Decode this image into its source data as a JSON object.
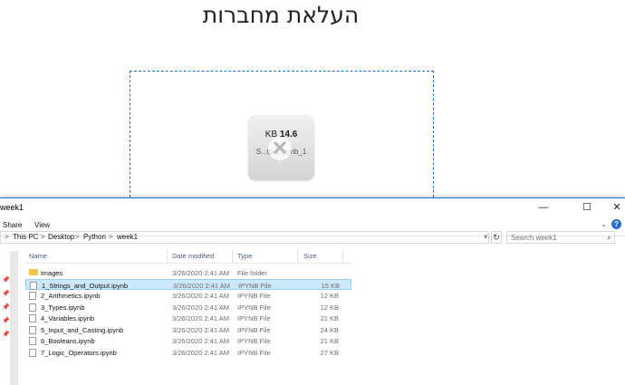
{
  "upload": {
    "title": "העלאת מחברות",
    "file_card": {
      "size_prefix": "KB ",
      "size_value": "14.6",
      "filename": "1_S...tput.ipynb",
      "remove_glyph": "✕"
    }
  },
  "explorer": {
    "title": "week1",
    "controls": {
      "minimize": "—",
      "maximize": "☐",
      "close": "✕"
    },
    "ribbon": {
      "tabs": [
        "Share",
        "View"
      ],
      "expand": "⌄",
      "help": "?"
    },
    "address": {
      "chevron": ">",
      "crumbs": [
        "This PC",
        "Desktop",
        "Python",
        "week1"
      ],
      "dropdown": "∨",
      "refresh": "↻"
    },
    "search": {
      "placeholder": "Search week1",
      "icon": "⌕"
    },
    "columns": {
      "name": "Name",
      "date": "Date modified",
      "type": "Type",
      "size": "Size"
    },
    "files": [
      {
        "name": "images",
        "date": "3/26/2020 2:41 AM",
        "type": "File folder",
        "size": "",
        "icon": "folder-icon"
      },
      {
        "name": "1_Strings_and_Output.ipynb",
        "date": "3/26/2020 2:41 AM",
        "type": "IPYNB File",
        "size": "15 KB",
        "icon": "file-icon",
        "selected": true
      },
      {
        "name": "2_Arithmetics.ipynb",
        "date": "3/26/2020 2:41 AM",
        "type": "IPYNB File",
        "size": "12 KB",
        "icon": "file-icon"
      },
      {
        "name": "3_Types.ipynb",
        "date": "3/26/2020 2:41 AM",
        "type": "IPYNB File",
        "size": "12 KB",
        "icon": "file-icon"
      },
      {
        "name": "4_Variables.ipynb",
        "date": "3/26/2020 2:41 AM",
        "type": "IPYNB File",
        "size": "21 KB",
        "icon": "file-icon"
      },
      {
        "name": "5_Input_and_Casting.ipynb",
        "date": "3/26/2020 2:41 AM",
        "type": "IPYNB File",
        "size": "24 KB",
        "icon": "file-icon"
      },
      {
        "name": "6_Booleans.ipynb",
        "date": "3/26/2020 2:41 AM",
        "type": "IPYNB File",
        "size": "21 KB",
        "icon": "file-icon"
      },
      {
        "name": "7_Logic_Operators.ipynb",
        "date": "3/26/2020 2:41 AM",
        "type": "IPYNB File",
        "size": "27 KB",
        "icon": "file-icon"
      }
    ],
    "pin_glyph": "📌"
  },
  "colors": {
    "accent": "#1a73c9",
    "selection": "#cce8ff",
    "folder": "#f2c54c"
  }
}
